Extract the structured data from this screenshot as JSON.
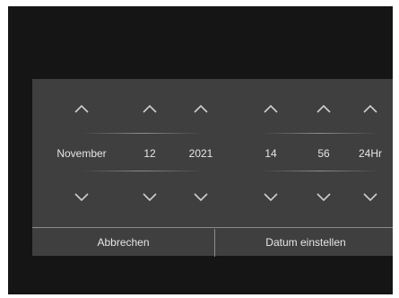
{
  "picker": {
    "columns": [
      {
        "id": "month",
        "value": "November"
      },
      {
        "id": "day",
        "value": "12"
      },
      {
        "id": "year",
        "value": "2021"
      },
      {
        "id": "hour",
        "value": "14"
      },
      {
        "id": "minute",
        "value": "56"
      },
      {
        "id": "clock_format",
        "value": "24Hr"
      }
    ]
  },
  "buttons": {
    "cancel_label": "Abbrechen",
    "set_label": "Datum einstellen"
  },
  "icons": {
    "increment": "chevron-up-icon",
    "decrement": "chevron-down-icon"
  },
  "colors": {
    "screen_background": "#151515",
    "dialog_background": "#3f3f3f",
    "text": "#e6e6e6",
    "divider": "#8a8a8a"
  }
}
